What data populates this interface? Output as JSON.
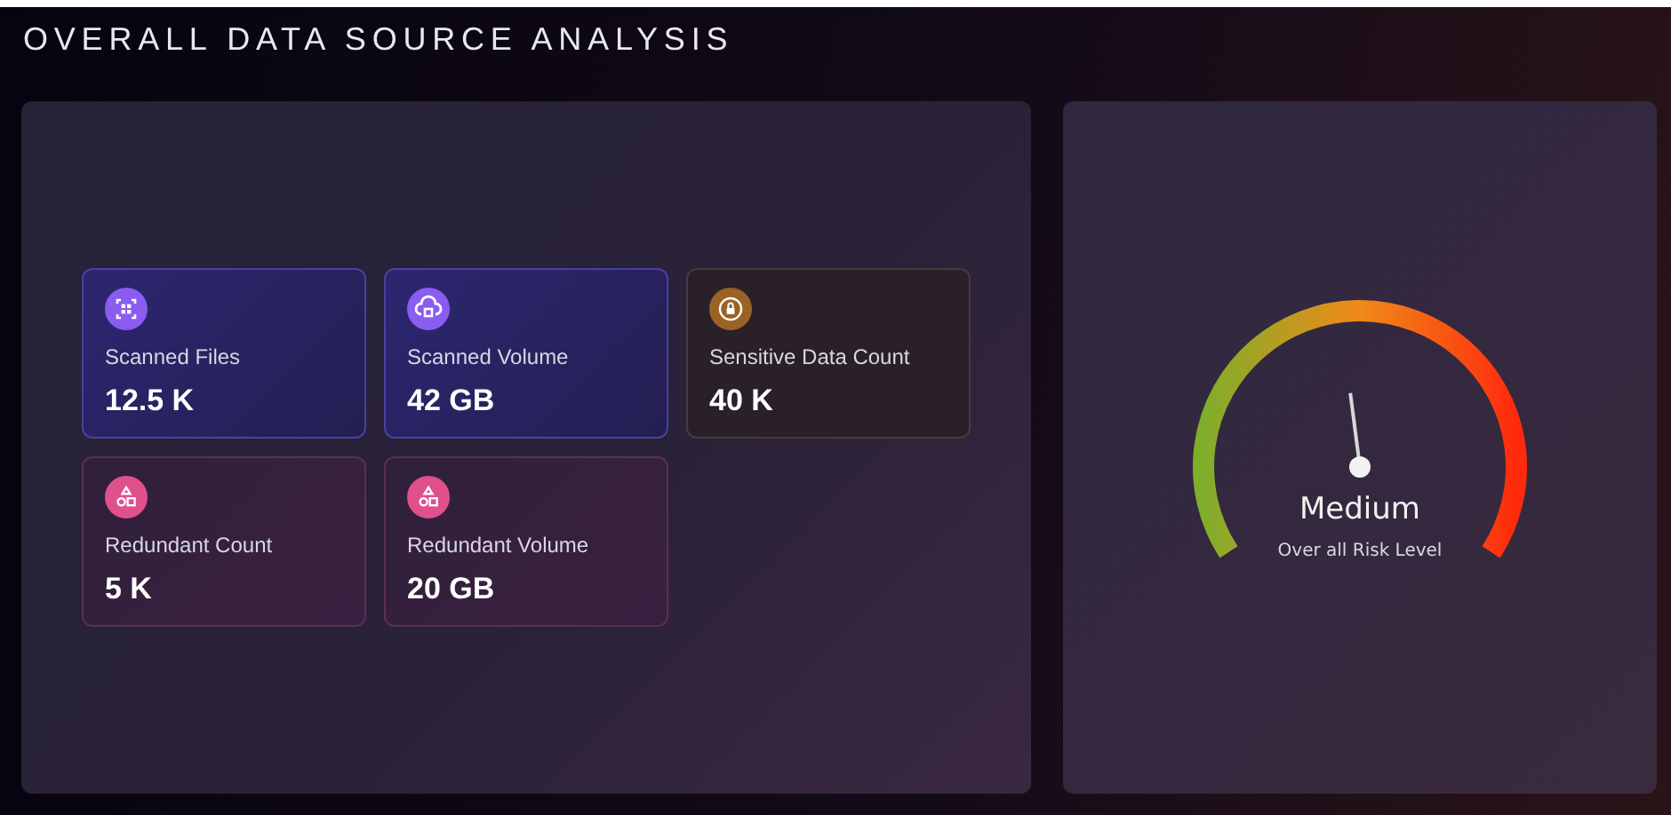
{
  "title": "OVERALL DATA SOURCE ANALYSIS",
  "stats": [
    {
      "label": "Scanned Files",
      "value": "12.5 K",
      "kind": "scan",
      "color": "#8a5cf0"
    },
    {
      "label": "Scanned Volume",
      "value": "42 GB",
      "kind": "cloud",
      "color": "#8a5cf0"
    },
    {
      "label": "Sensitive Data Count",
      "value": "40 K",
      "kind": "lock",
      "color": "#9a6326"
    },
    {
      "label": "Redundant Count",
      "value": "5 K",
      "kind": "shapes",
      "color": "#e0508c"
    },
    {
      "label": "Redundant Volume",
      "value": "20 GB",
      "kind": "shapes",
      "color": "#e0508c"
    }
  ],
  "risk": {
    "rating": "Medium",
    "caption": "Over all Risk Level"
  }
}
